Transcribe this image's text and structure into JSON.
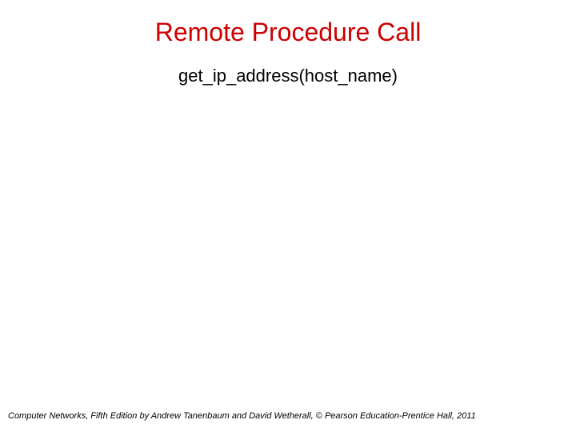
{
  "slide": {
    "title": "Remote Procedure Call",
    "code": "get_ip_address(host_name)",
    "footer": "Computer Networks, Fifth Edition by Andrew Tanenbaum and David Wetherall, © Pearson Education-Prentice Hall, 2011"
  }
}
